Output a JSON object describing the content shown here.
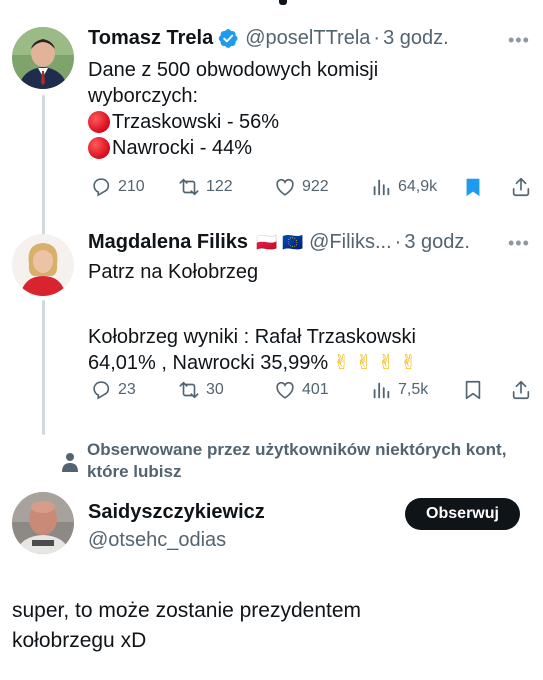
{
  "tweets": [
    {
      "name": "Tomasz Trela",
      "handle": "@poselTTrela",
      "time": "3 godz.",
      "verified": true,
      "lines": [
        "Dane z 500 obwodowych komisji",
        "wyborczych:",
        "Trzaskowski - 56%",
        "Nawrocki - 44%"
      ],
      "replies": "210",
      "retweets": "122",
      "likes": "922",
      "views": "64,9k",
      "bookmarked": true
    },
    {
      "name": "Magdalena Filiks",
      "flags": "🇵🇱 🇪🇺",
      "handle": "@Filiks...",
      "time": "3 godz.",
      "lines": [
        "Patrz na Kołobrzeg",
        "",
        "Kołobrzeg  wyniki : Rafał Trzaskowski",
        "64,01% , Nawrocki 35,99%"
      ],
      "emoji_tail": "✌ ✌ ✌ ✌",
      "replies": "23",
      "retweets": "30",
      "likes": "401",
      "views": "7,5k",
      "bookmarked": false
    }
  ],
  "social_context": "Obserwowane przez użytkowników niektórych kont, które lubisz",
  "account": {
    "name": "Saidyszczykiewicz",
    "handle": "@otsehc_odias",
    "follow_label": "Obserwuj"
  },
  "reply_text": [
    "super, to może zostanie prezydentem",
    "kołobrzegu xD"
  ],
  "colors": {
    "text": "#0f1419",
    "secondary": "#536471",
    "verified": "#1d9bf0",
    "bookmark_active": "#1d9bf0",
    "thread_line": "#cfd9de",
    "follow_bg": "#0f1419"
  },
  "icons": [
    "more-icon",
    "reply-icon",
    "retweet-icon",
    "like-icon",
    "views-icon",
    "bookmark-icon",
    "share-icon",
    "verified-icon",
    "person-icon"
  ]
}
